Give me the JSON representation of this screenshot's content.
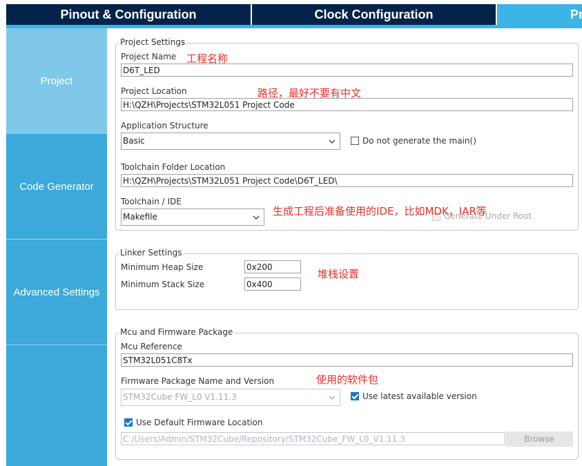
{
  "tabs": [
    {
      "label": "Pinout & Configuration"
    },
    {
      "label": "Clock Configuration"
    },
    {
      "label": "Pr"
    }
  ],
  "sidebar": {
    "items": [
      {
        "label": "Project"
      },
      {
        "label": "Code Generator"
      },
      {
        "label": "Advanced Settings"
      }
    ]
  },
  "project_settings": {
    "legend": "Project Settings",
    "project_name_label": "Project Name",
    "project_name_value": "D6T_LED",
    "project_location_label": "Project Location",
    "project_location_value": "H:\\QZH\\Projects\\STM32L051 Project Code",
    "app_structure_label": "Application Structure",
    "app_structure_value": "Basic",
    "no_main_label": "Do not generate the main()",
    "toolchain_folder_label": "Toolchain Folder Location",
    "toolchain_folder_value": "H:\\QZH\\Projects\\STM32L051 Project Code\\D6T_LED\\",
    "toolchain_ide_label": "Toolchain / IDE",
    "toolchain_ide_value": "Makefile",
    "generate_under_root_label": "Generate Under Root"
  },
  "linker_settings": {
    "legend": "Linker Settings",
    "heap_label": "Minimum Heap Size",
    "heap_value": "0x200",
    "stack_label": "Minimum Stack Size",
    "stack_value": "0x400"
  },
  "mcu_firmware": {
    "legend": "Mcu and Firmware Package",
    "mcu_ref_label": "Mcu Reference",
    "mcu_ref_value": "STM32L051C8Tx",
    "fw_name_label": "Firmware Package Name and Version",
    "fw_name_value": "STM32Cube FW_L0 V1.11.3",
    "use_latest_label": "Use latest available version",
    "use_default_loc_label": "Use Default Firmware Location",
    "fw_location_value": "C:/Users/Admin/STM32Cube/Repository/STM32Cube_FW_L0_V1.11.3",
    "browse_label": "Browse"
  },
  "annotations": {
    "project_name": "工程名称",
    "project_location": "路径，最好不要有中文",
    "toolchain": "生成工程后准备使用的IDE，比如MDK，IAR等",
    "stack": "堆栈设置",
    "firmware": "使用的软件包"
  },
  "colors": {
    "tab_dark": "#03234b",
    "tab_active": "#3cb4e6",
    "sidebar": "#3ba9d9",
    "sidebar_active": "#7fc8ea",
    "annotation": "#e8302b"
  }
}
